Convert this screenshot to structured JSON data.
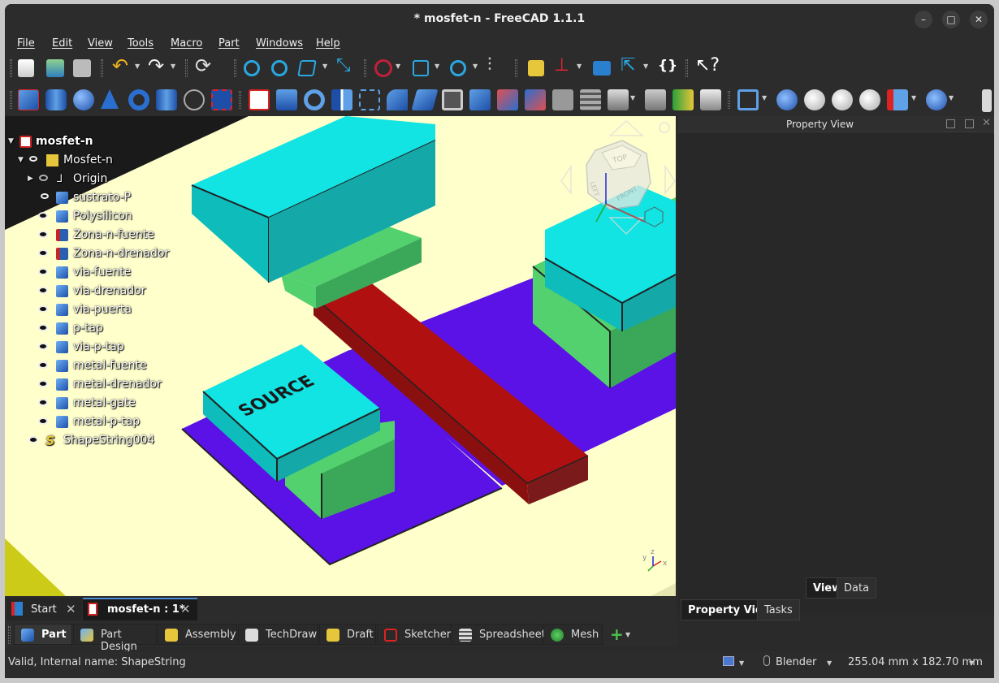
{
  "window": {
    "title": "* mosfet-n - FreeCAD 1.1.1"
  },
  "menu": [
    "File",
    "Edit",
    "View",
    "Tools",
    "Macro",
    "Part",
    "Windows",
    "Help"
  ],
  "tree": {
    "document": "mosfet-n",
    "items": [
      {
        "label": "Mosfet-n",
        "icon": "assembly-icon"
      },
      {
        "label": "Origin",
        "icon": "origin-icon"
      },
      {
        "label": "sustrato-P",
        "icon": "cube-icon"
      },
      {
        "label": "Polysilicon",
        "icon": "cube-icon"
      },
      {
        "label": "Zona-n-fuente",
        "icon": "cut-icon"
      },
      {
        "label": "Zona-n-drenador",
        "icon": "cut-icon"
      },
      {
        "label": "via-fuente",
        "icon": "cube-icon"
      },
      {
        "label": "via-drenador",
        "icon": "cube-icon"
      },
      {
        "label": "via-puerta",
        "icon": "cube-icon"
      },
      {
        "label": "p-tap",
        "icon": "cube-icon"
      },
      {
        "label": "via-p-tap",
        "icon": "cube-icon"
      },
      {
        "label": "metal-fuente",
        "icon": "cube-icon"
      },
      {
        "label": "metal-drenador",
        "icon": "cube-icon"
      },
      {
        "label": "metal-gate",
        "icon": "cube-icon"
      },
      {
        "label": "metal-p-tap",
        "icon": "cube-icon"
      },
      {
        "label": "ShapeString004",
        "icon": "shapestring-icon"
      }
    ]
  },
  "viewport": {
    "source_text": "SOURCE",
    "navcube": {
      "top": "TOP",
      "left": "LEFT",
      "front": "FRONT"
    },
    "axes": {
      "x": "x",
      "y": "y",
      "z": "z"
    }
  },
  "property_view": {
    "title": "Property View",
    "tabs": [
      "View",
      "Data"
    ],
    "bottom_tabs": [
      "Property View",
      "Tasks"
    ]
  },
  "doc_tabs": [
    {
      "label": "Start"
    },
    {
      "label": "mosfet-n : 1*"
    }
  ],
  "workbenches": [
    "Part",
    "Part Design",
    "Assembly",
    "TechDraw",
    "Draft",
    "Sketcher",
    "Spreadsheet",
    "Mesh"
  ],
  "status": {
    "message": "Valid, Internal name: ShapeString",
    "nav_style": "Blender",
    "dimensions": "255.04 mm x 182.70 mm"
  },
  "colors": {
    "background": "#ffffcc",
    "cyan": "#12e3e3",
    "green": "#52d16e",
    "purple": "#5a12e6",
    "red": "#b01010",
    "yellow": "#cccc18"
  }
}
